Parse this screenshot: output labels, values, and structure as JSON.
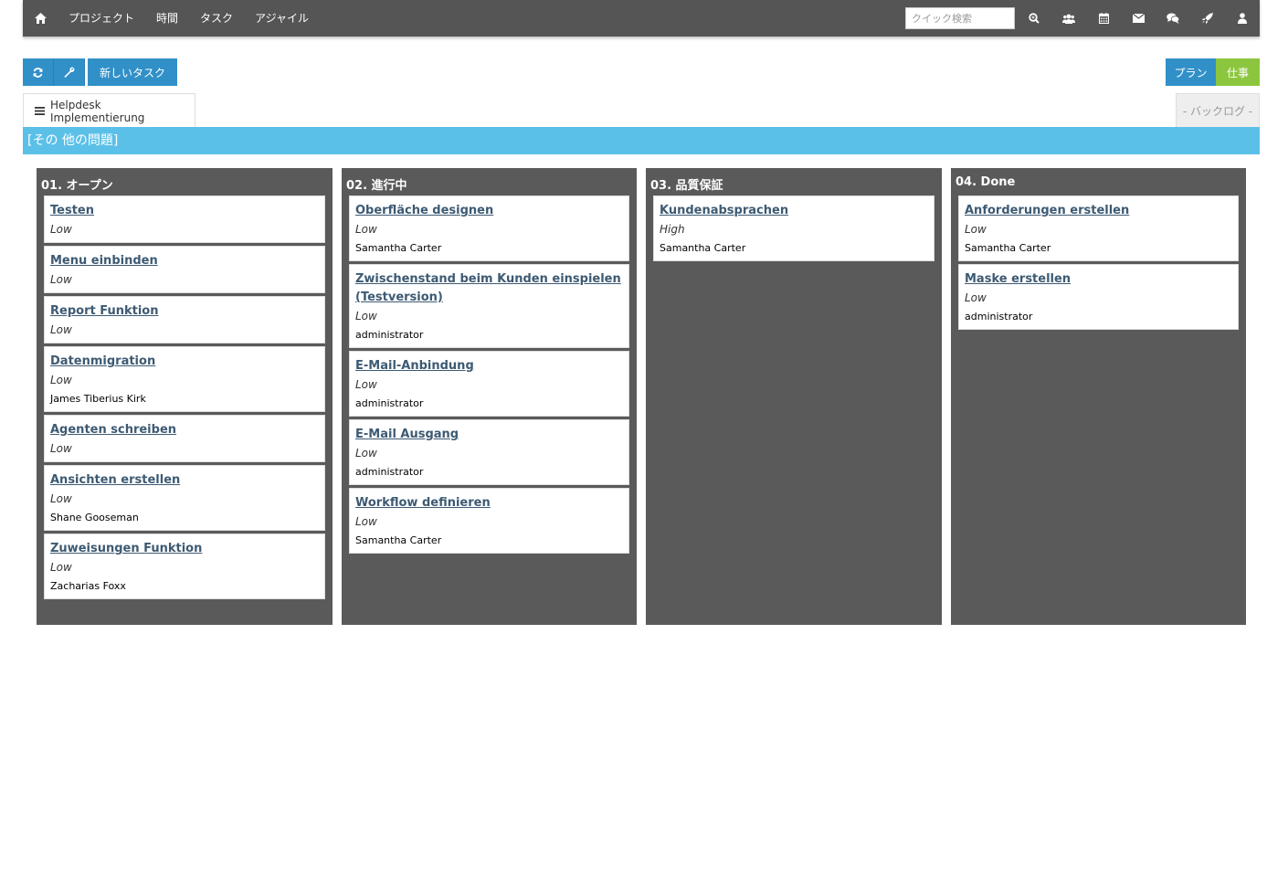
{
  "nav": {
    "items": [
      "プロジェクト",
      "時間",
      "タスク",
      "アジャイル"
    ],
    "search_placeholder": "クイック検索"
  },
  "toolbar": {
    "new_task_label": "新しいタスク"
  },
  "view_toggle": {
    "plan": "プラン",
    "work": "仕事"
  },
  "tabs": {
    "active": "Helpdesk Implementierung",
    "backlog": "- バックログ -"
  },
  "group": {
    "label": "[その 他の問題]"
  },
  "board": {
    "columns": [
      {
        "title": "01. オープン",
        "cards": [
          {
            "title": "Testen",
            "priority": "Low",
            "assignee": ""
          },
          {
            "title": "Menu einbinden",
            "priority": "Low",
            "assignee": ""
          },
          {
            "title": "Report Funktion",
            "priority": "Low",
            "assignee": ""
          },
          {
            "title": "Datenmigration",
            "priority": "Low",
            "assignee": "James Tiberius Kirk"
          },
          {
            "title": "Agenten schreiben",
            "priority": "Low",
            "assignee": ""
          },
          {
            "title": "Ansichten erstellen",
            "priority": "Low",
            "assignee": "Shane Gooseman"
          },
          {
            "title": "Zuweisungen Funktion",
            "priority": "Low",
            "assignee": "Zacharias Foxx"
          }
        ]
      },
      {
        "title": "02. 進行中",
        "cards": [
          {
            "title": "Oberfläche designen",
            "priority": "Low",
            "assignee": "Samantha Carter"
          },
          {
            "title": "Zwischenstand beim Kunden einspielen (Testversion)",
            "priority": "Low",
            "assignee": "administrator"
          },
          {
            "title": "E-Mail-Anbindung",
            "priority": "Low",
            "assignee": "administrator"
          },
          {
            "title": "E-Mail Ausgang",
            "priority": "Low",
            "assignee": "administrator"
          },
          {
            "title": "Workflow definieren",
            "priority": "Low",
            "assignee": "Samantha Carter"
          }
        ]
      },
      {
        "title": "03. 品質保証",
        "cards": [
          {
            "title": "Kundenabsprachen",
            "priority": "High",
            "assignee": "Samantha Carter"
          }
        ]
      },
      {
        "title": "04. Done",
        "cards": [
          {
            "title": "Anforderungen erstellen",
            "priority": "Low",
            "assignee": "Samantha Carter"
          },
          {
            "title": "Maske erstellen",
            "priority": "Low",
            "assignee": "administrator"
          }
        ]
      }
    ]
  }
}
